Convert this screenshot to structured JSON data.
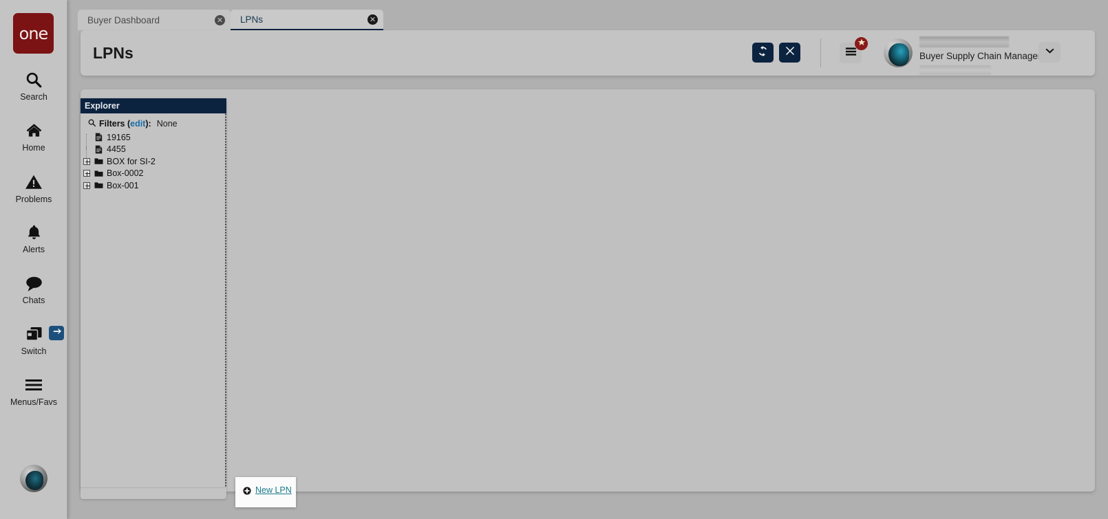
{
  "brand": {
    "logo_text": "one",
    "logo_color": "#7b1214"
  },
  "rail": {
    "items": [
      {
        "label": "Search",
        "icon": "search-icon"
      },
      {
        "label": "Home",
        "icon": "home-icon"
      },
      {
        "label": "Problems",
        "icon": "warning-triangle-icon"
      },
      {
        "label": "Alerts",
        "icon": "bell-icon"
      },
      {
        "label": "Chats",
        "icon": "chat-bubble-icon"
      },
      {
        "label": "Switch",
        "icon": "windows-stack-icon"
      },
      {
        "label": "Menus/Favs",
        "icon": "hamburger-icon"
      }
    ],
    "switch_badge_icon": "exchange-arrows-icon",
    "avatar_icon": "user-avatar"
  },
  "tabs": [
    {
      "label": "Buyer Dashboard",
      "active": false,
      "close_icon": "close-circle-icon"
    },
    {
      "label": "LPNs",
      "active": true,
      "close_icon": "close-circle-icon"
    }
  ],
  "header": {
    "title": "LPNs",
    "refresh_icon": "refresh-icon",
    "close_icon": "x-icon",
    "menus_icon": "hamburger-icon",
    "menus_badge_icon": "star-icon",
    "badge_color": "#8b1a1a",
    "accent_color": "#0c2340",
    "user": {
      "name_redacted": true,
      "role": "Buyer Supply Chain Manager",
      "org_redacted": true,
      "caret_icon": "chevron-down-icon"
    }
  },
  "explorer": {
    "title": "Explorer",
    "filters": {
      "search_icon": "search-icon",
      "label": "Filters (",
      "edit_label": "edit",
      "label_end": "):",
      "value": "None"
    },
    "tree": [
      {
        "label": "19165",
        "type": "file",
        "icon": "document-icon",
        "expandable": false
      },
      {
        "label": "4455",
        "type": "file",
        "icon": "document-icon",
        "expandable": false
      },
      {
        "label": "BOX for SI-2",
        "type": "folder",
        "icon": "folder-icon",
        "expandable": true
      },
      {
        "label": "Box-0002",
        "type": "folder",
        "icon": "folder-icon",
        "expandable": true
      },
      {
        "label": "Box-001",
        "type": "folder",
        "icon": "folder-icon",
        "expandable": true
      }
    ]
  },
  "new_lpn": {
    "label": "New LPN",
    "icon": "plus-circle-icon",
    "link_color": "#1b7a8c"
  }
}
